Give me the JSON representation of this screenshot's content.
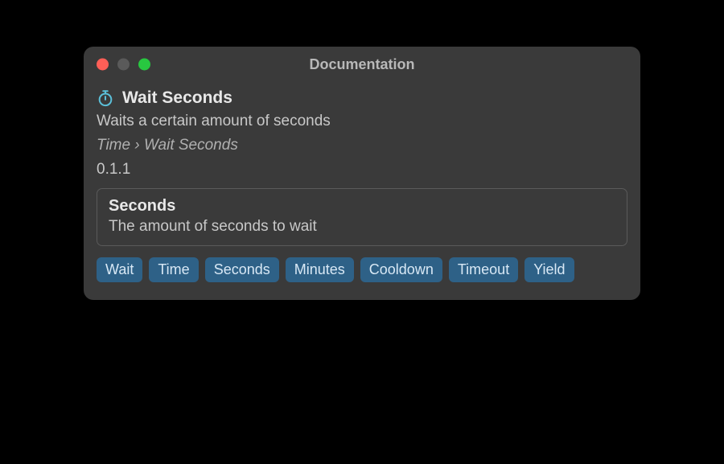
{
  "window": {
    "title": "Documentation"
  },
  "node": {
    "title": "Wait Seconds",
    "description": "Waits a certain amount of seconds",
    "breadcrumb": "Time › Wait Seconds",
    "version": "0.1.1"
  },
  "parameter": {
    "name": "Seconds",
    "description": "The amount of seconds to wait"
  },
  "tags": [
    "Wait",
    "Time",
    "Seconds",
    "Minutes",
    "Cooldown",
    "Timeout",
    "Yield"
  ],
  "colors": {
    "icon": "#5bbfd8",
    "tag_bg": "#2e6187"
  }
}
